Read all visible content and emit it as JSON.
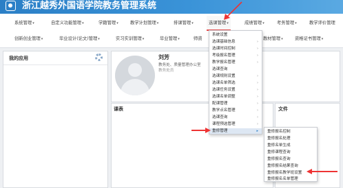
{
  "app": {
    "title": "浙江越秀外国语学院教务管理系统"
  },
  "nav": {
    "row1": [
      {
        "label": "系统管理"
      },
      {
        "label": "自定义功能管理"
      },
      {
        "label": "学籍管理"
      },
      {
        "label": "教学计划管理"
      },
      {
        "label": "排课管理"
      },
      {
        "label": "选课管理",
        "active": true
      },
      {
        "label": "成绩管理"
      },
      {
        "label": "考务管理"
      },
      {
        "label": "教学评价管理"
      }
    ],
    "row2": [
      {
        "label": "创新创业管理"
      },
      {
        "label": "毕业设计(论文)管理"
      },
      {
        "label": "实习实训管理"
      },
      {
        "label": "毕业管理"
      },
      {
        "label": "师资"
      },
      {
        "label": "教材管理"
      },
      {
        "label": "资格证书管理"
      }
    ]
  },
  "my_apps": {
    "title": "我的应用"
  },
  "user": {
    "name": "刘芳",
    "role": "教务处、质量管理办公室",
    "dept": "教务处员"
  },
  "course_panel": {
    "title": "课表"
  },
  "files_panel": {
    "title": "文件"
  },
  "dropdown": {
    "items": [
      {
        "label": "系统设置",
        "arrow": ""
      },
      {
        "label": "选课基础信息",
        "arrow": "›"
      },
      {
        "label": "选课时间控制",
        "arrow": "›"
      },
      {
        "label": "考级报名管理",
        "arrow": "›"
      },
      {
        "label": "教学报名管理",
        "arrow": "›"
      },
      {
        "label": "选课查询",
        "arrow": ""
      },
      {
        "label": "选课规则设置",
        "arrow": "›"
      },
      {
        "label": "选课名单筛选",
        "arrow": "›"
      },
      {
        "label": "选课任务设置",
        "arrow": "›"
      },
      {
        "label": "选课名单调整",
        "arrow": "›"
      },
      {
        "label": "配课管理",
        "arrow": "›"
      },
      {
        "label": "教学点名管理",
        "arrow": "›"
      },
      {
        "label": "选课查询",
        "arrow": "›"
      },
      {
        "label": "课程预选管理",
        "arrow": "›"
      },
      {
        "label": "重修管理",
        "arrow": "▸",
        "highlight": true
      }
    ]
  },
  "submenu": {
    "items": [
      {
        "label": "重修报名控制"
      },
      {
        "label": "重修报名处理"
      },
      {
        "label": "重修名单生成"
      },
      {
        "label": "重修课程查询"
      },
      {
        "label": "重修报名查询"
      },
      {
        "label": "重修报名结果查询"
      },
      {
        "label": "重修报名教学班设置"
      },
      {
        "label": "重修报名名单管理"
      }
    ]
  },
  "colors": {
    "banner": "#2b7fc6",
    "accent_red": "#e54b4b",
    "highlight": "#dde7f3"
  }
}
